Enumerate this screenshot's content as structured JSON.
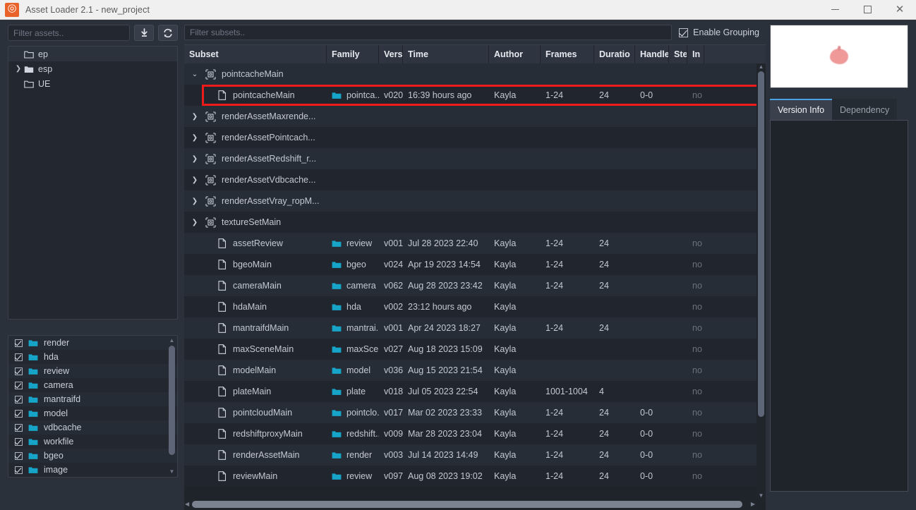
{
  "window": {
    "title": "Asset Loader 2.1 - new_project",
    "app_icon": "spiral-logo-icon",
    "accent_orange": "#e8622a",
    "minimize_label": "",
    "maximize_label": "",
    "close_label": "✕"
  },
  "sidebar": {
    "filter_placeholder": "Filter assets..",
    "download_icon": "download-arrow-icon",
    "refresh_icon": "refresh-icon",
    "tree": [
      {
        "label": "ep",
        "expandable": false,
        "selected": true
      },
      {
        "label": "esp",
        "expandable": true,
        "selected": false
      },
      {
        "label": "UE",
        "expandable": false,
        "selected": false
      }
    ],
    "families": [
      {
        "label": "render",
        "checked": true
      },
      {
        "label": "hda",
        "checked": true
      },
      {
        "label": "review",
        "checked": true
      },
      {
        "label": "camera",
        "checked": true
      },
      {
        "label": "mantraifd",
        "checked": true
      },
      {
        "label": "model",
        "checked": true
      },
      {
        "label": "vdbcache",
        "checked": true
      },
      {
        "label": "workfile",
        "checked": true
      },
      {
        "label": "bgeo",
        "checked": true
      },
      {
        "label": "image",
        "checked": true
      },
      {
        "label": "",
        "checked": true
      }
    ]
  },
  "toolbar": {
    "subset_filter_placeholder": "Filter subsets..",
    "grouping_label": "Enable Grouping",
    "grouping_checked": true
  },
  "table": {
    "columns": [
      "Subset",
      "Family",
      "Version",
      "Time",
      "Author",
      "Frames",
      "Duratio",
      "Handle",
      "Step",
      "In"
    ],
    "rows": [
      {
        "kind": "group",
        "expanded": true,
        "subset": "pointcacheMain",
        "family": "",
        "version": "",
        "time": "",
        "author": "",
        "frames": "",
        "duration": "",
        "handle": "",
        "step": "",
        "in": ""
      },
      {
        "kind": "item",
        "highlighted": true,
        "subset": "pointcacheMain",
        "family": "pointca...",
        "version": "v020",
        "time": "16:39 hours ago",
        "author": "Kayla",
        "frames": "1-24",
        "duration": "24",
        "handle": "0-0",
        "step": "",
        "in": "no"
      },
      {
        "kind": "group",
        "expanded": false,
        "subset": "renderAssetMaxrende...",
        "family": "",
        "version": "",
        "time": "",
        "author": "",
        "frames": "",
        "duration": "",
        "handle": "",
        "step": "",
        "in": ""
      },
      {
        "kind": "group",
        "expanded": false,
        "subset": "renderAssetPointcach...",
        "family": "",
        "version": "",
        "time": "",
        "author": "",
        "frames": "",
        "duration": "",
        "handle": "",
        "step": "",
        "in": ""
      },
      {
        "kind": "group",
        "expanded": false,
        "subset": "renderAssetRedshift_r...",
        "family": "",
        "version": "",
        "time": "",
        "author": "",
        "frames": "",
        "duration": "",
        "handle": "",
        "step": "",
        "in": ""
      },
      {
        "kind": "group",
        "expanded": false,
        "subset": "renderAssetVdbcache...",
        "family": "",
        "version": "",
        "time": "",
        "author": "",
        "frames": "",
        "duration": "",
        "handle": "",
        "step": "",
        "in": ""
      },
      {
        "kind": "group",
        "expanded": false,
        "subset": "renderAssetVray_ropM...",
        "family": "",
        "version": "",
        "time": "",
        "author": "",
        "frames": "",
        "duration": "",
        "handle": "",
        "step": "",
        "in": ""
      },
      {
        "kind": "group",
        "expanded": false,
        "subset": "textureSetMain",
        "family": "",
        "version": "",
        "time": "",
        "author": "",
        "frames": "",
        "duration": "",
        "handle": "",
        "step": "",
        "in": ""
      },
      {
        "kind": "item",
        "subset": "assetReview",
        "family": "review",
        "version": "v001",
        "time": "Jul 28 2023 22:40",
        "author": "Kayla",
        "frames": "1-24",
        "duration": "24",
        "handle": "",
        "step": "",
        "in": "no"
      },
      {
        "kind": "item",
        "subset": "bgeoMain",
        "family": "bgeo",
        "version": "v024",
        "time": "Apr 19 2023 14:54",
        "author": "Kayla",
        "frames": "1-24",
        "duration": "24",
        "handle": "",
        "step": "",
        "in": "no"
      },
      {
        "kind": "item",
        "subset": "cameraMain",
        "family": "camera",
        "version": "v062",
        "time": "Aug 28 2023 23:42",
        "author": "Kayla",
        "frames": "1-24",
        "duration": "24",
        "handle": "",
        "step": "",
        "in": "no"
      },
      {
        "kind": "item",
        "subset": "hdaMain",
        "family": "hda",
        "version": "v002",
        "time": "23:12 hours ago",
        "author": "Kayla",
        "frames": "",
        "duration": "",
        "handle": "",
        "step": "",
        "in": "no"
      },
      {
        "kind": "item",
        "subset": "mantraifdMain",
        "family": "mantrai...",
        "version": "v001",
        "time": "Apr 24 2023 18:27",
        "author": "Kayla",
        "frames": "1-24",
        "duration": "24",
        "handle": "",
        "step": "",
        "in": "no"
      },
      {
        "kind": "item",
        "subset": "maxSceneMain",
        "family": "maxSce...",
        "version": "v027",
        "time": "Aug 18 2023 15:09",
        "author": "Kayla",
        "frames": "",
        "duration": "",
        "handle": "",
        "step": "",
        "in": "no"
      },
      {
        "kind": "item",
        "subset": "modelMain",
        "family": "model",
        "version": "v036",
        "time": "Aug 15 2023 21:54",
        "author": "Kayla",
        "frames": "",
        "duration": "",
        "handle": "",
        "step": "",
        "in": "no"
      },
      {
        "kind": "item",
        "subset": "plateMain",
        "family": "plate",
        "version": "v018",
        "time": "Jul 05 2023 22:54",
        "author": "Kayla",
        "frames": "1001-1004",
        "duration": "4",
        "handle": "",
        "step": "",
        "in": "no"
      },
      {
        "kind": "item",
        "subset": "pointcloudMain",
        "family": "pointclo...",
        "version": "v017",
        "time": "Mar 02 2023 23:33",
        "author": "Kayla",
        "frames": "1-24",
        "duration": "24",
        "handle": "0-0",
        "step": "",
        "in": "no"
      },
      {
        "kind": "item",
        "subset": "redshiftproxyMain",
        "family": "redshift...",
        "version": "v009",
        "time": "Mar 28 2023 23:04",
        "author": "Kayla",
        "frames": "1-24",
        "duration": "24",
        "handle": "0-0",
        "step": "",
        "in": "no"
      },
      {
        "kind": "item",
        "subset": "renderAssetMain",
        "family": "render",
        "version": "v003",
        "time": "Jul 14 2023 14:49",
        "author": "Kayla",
        "frames": "1-24",
        "duration": "24",
        "handle": "0-0",
        "step": "",
        "in": "no"
      },
      {
        "kind": "item",
        "subset": "reviewMain",
        "family": "review",
        "version": "v097",
        "time": "Aug 08 2023 19:02",
        "author": "Kayla",
        "frames": "1-24",
        "duration": "24",
        "handle": "0-0",
        "step": "",
        "in": "no"
      }
    ]
  },
  "rightpanel": {
    "thumbnail_alt": "asset-preview-thumbnail",
    "tabs": [
      {
        "label": "Version Info",
        "active": true
      },
      {
        "label": "Dependency",
        "active": false
      }
    ]
  },
  "colors": {
    "folder_cyan": "#16a5c9",
    "highlight_red": "#f01a1a",
    "tab_accent": "#4aa3e0"
  }
}
